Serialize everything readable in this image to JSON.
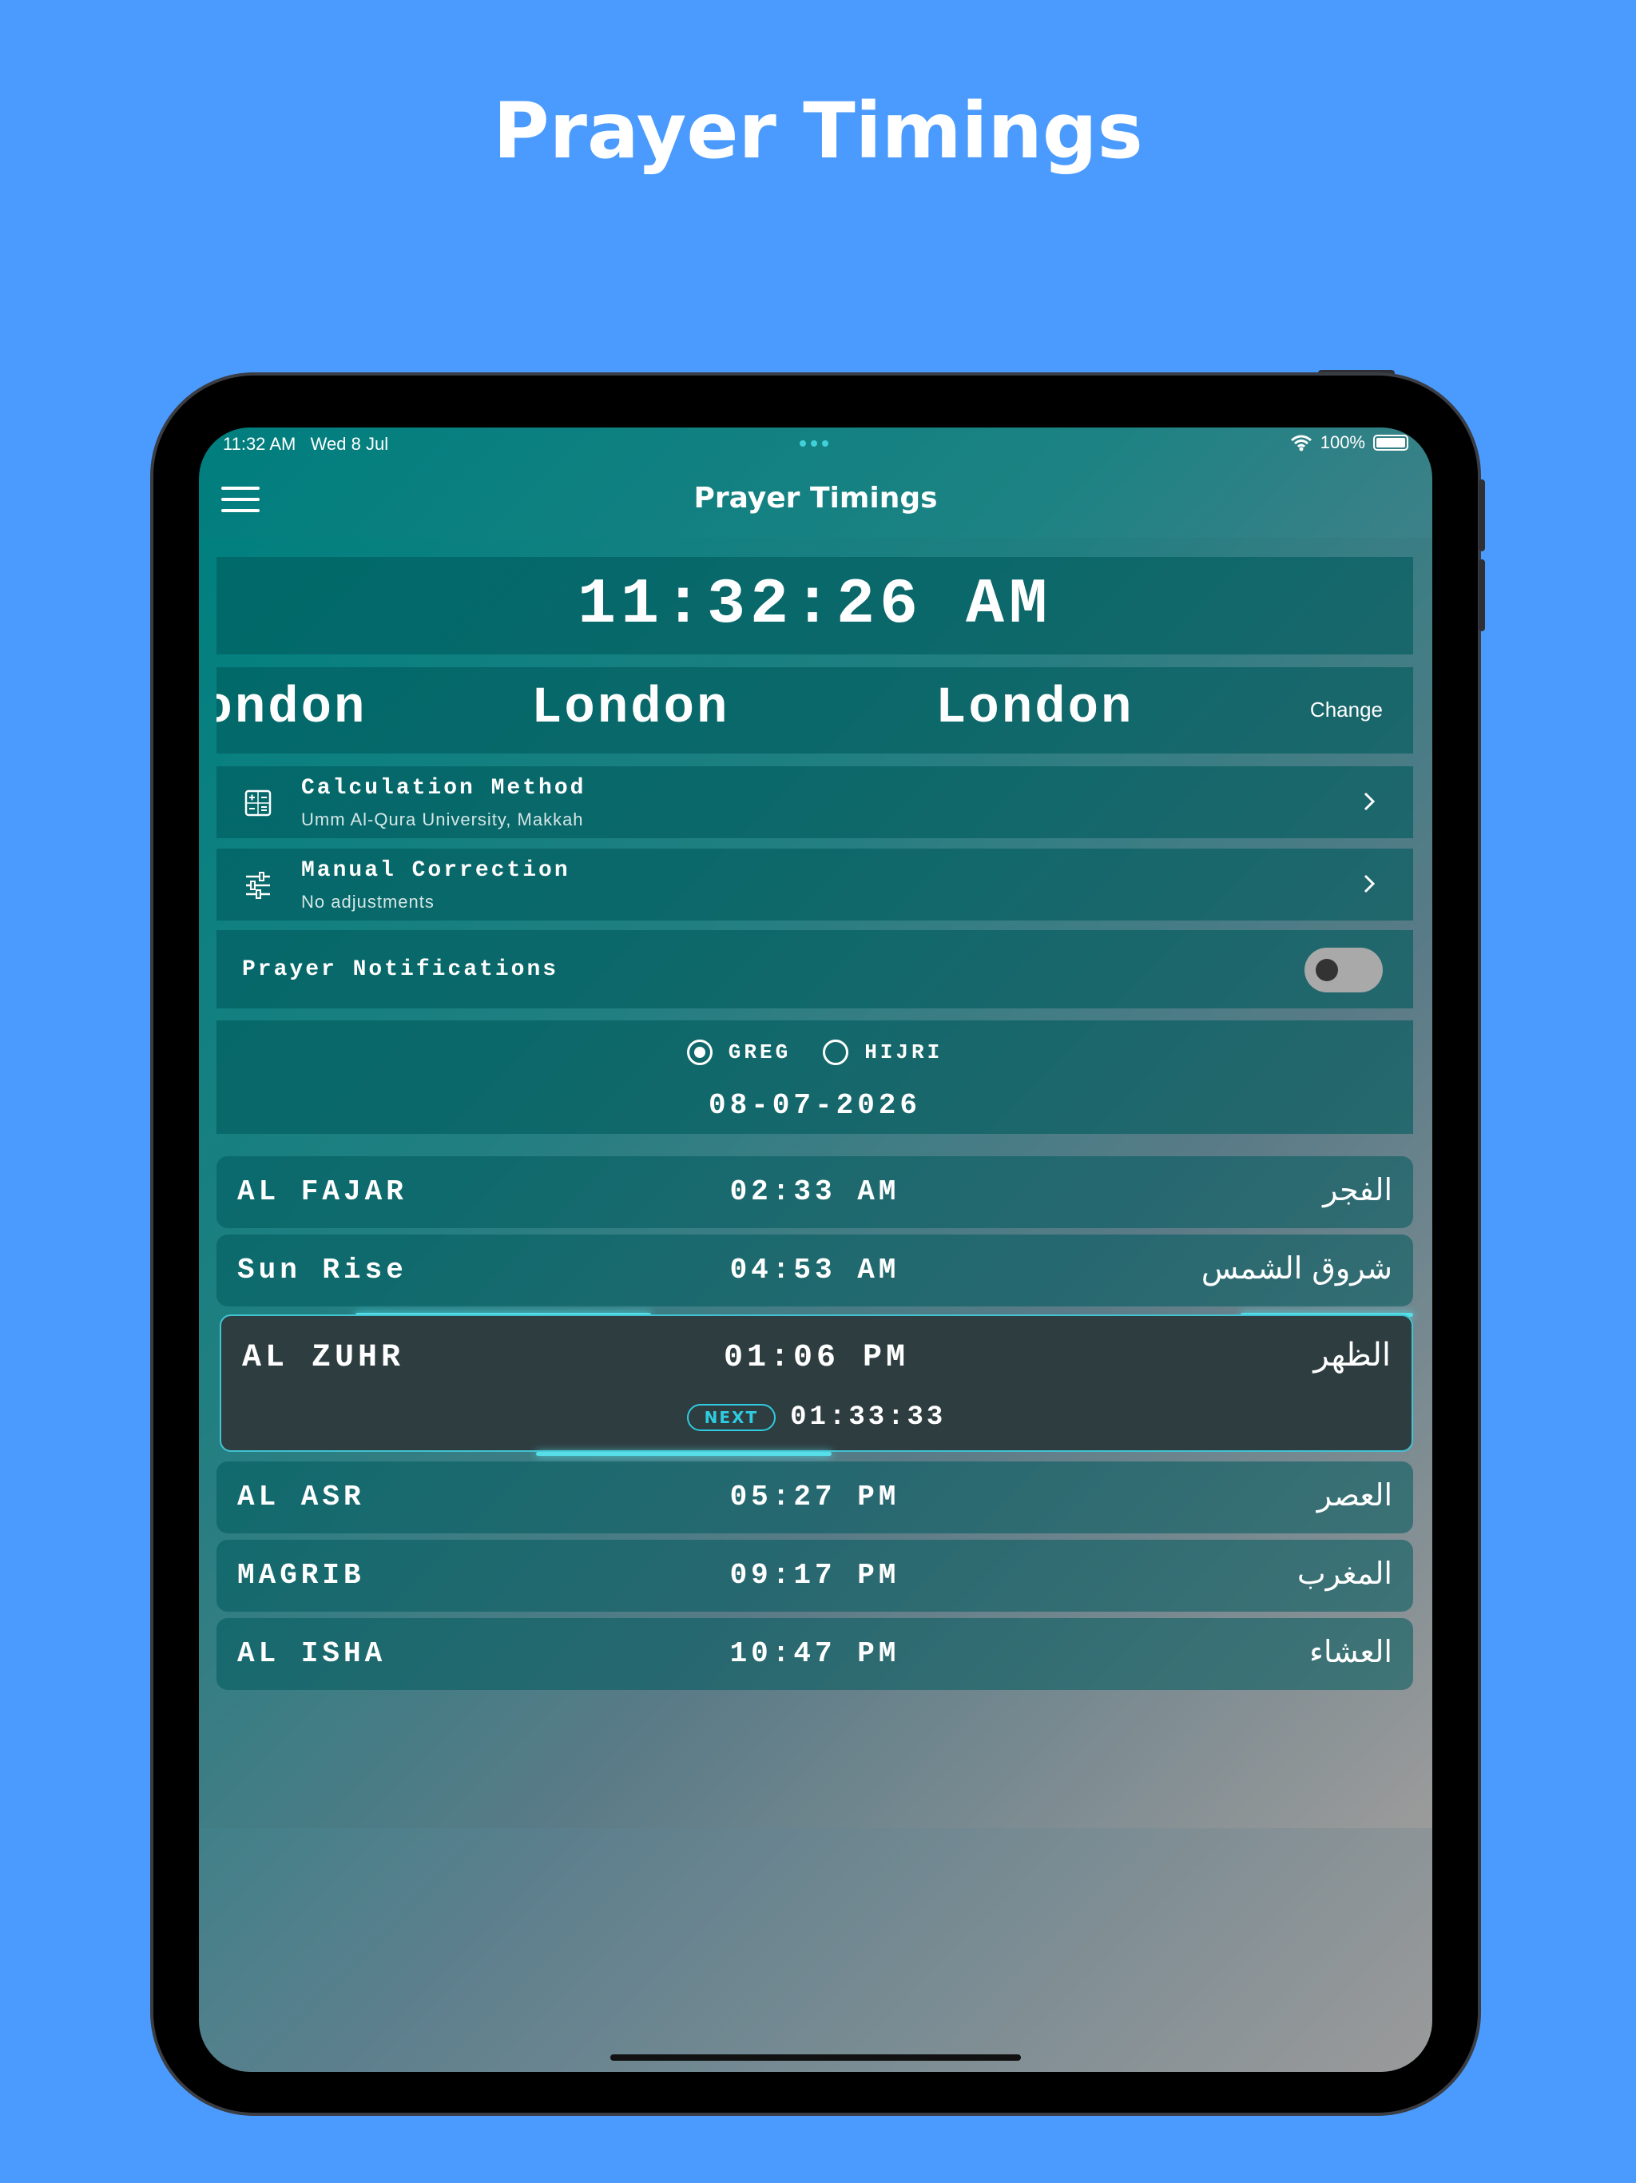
{
  "page_title": "Prayer Timings",
  "status": {
    "time": "11:32 AM",
    "date": "Wed 8 Jul",
    "battery": "100%"
  },
  "nav": {
    "title": "Prayer Timings"
  },
  "clock": "11:32:26 AM",
  "city": {
    "names": [
      "London",
      "London",
      "London"
    ],
    "change_label": "Change"
  },
  "settings": [
    {
      "title": "Calculation Method",
      "subtitle": "Umm Al-Qura University, Makkah",
      "icon": "calculator-icon"
    },
    {
      "title": "Manual Correction",
      "subtitle": "No adjustments",
      "icon": "sliders-icon"
    }
  ],
  "notifications": {
    "label": "Prayer Notifications",
    "enabled": false
  },
  "calendar": {
    "options": [
      "GREG",
      "HIJRI"
    ],
    "selected": "GREG",
    "date": "08-07-2026"
  },
  "prayers": [
    {
      "name": "AL FAJAR",
      "time": "02:33 AM",
      "arabic": "الفجر"
    },
    {
      "name": "Sun Rise",
      "time": "04:53 AM",
      "arabic": "شروق الشمس"
    },
    {
      "name": "AL ZUHR",
      "time": "01:06 PM",
      "arabic": "الظهر",
      "next": true,
      "badge": "NEXT",
      "countdown": "01:33:33"
    },
    {
      "name": "AL ASR",
      "time": "05:27 PM",
      "arabic": "العصر"
    },
    {
      "name": "MAGRIB",
      "time": "09:17 PM",
      "arabic": "المغرب"
    },
    {
      "name": "AL ISHA",
      "time": "10:47 PM",
      "arabic": "العشاء"
    }
  ],
  "colors": {
    "background": "#4b9bfe",
    "teal": "#007e7e",
    "next_accent": "#2fcbe0",
    "next_bg": "#2e3d40"
  }
}
